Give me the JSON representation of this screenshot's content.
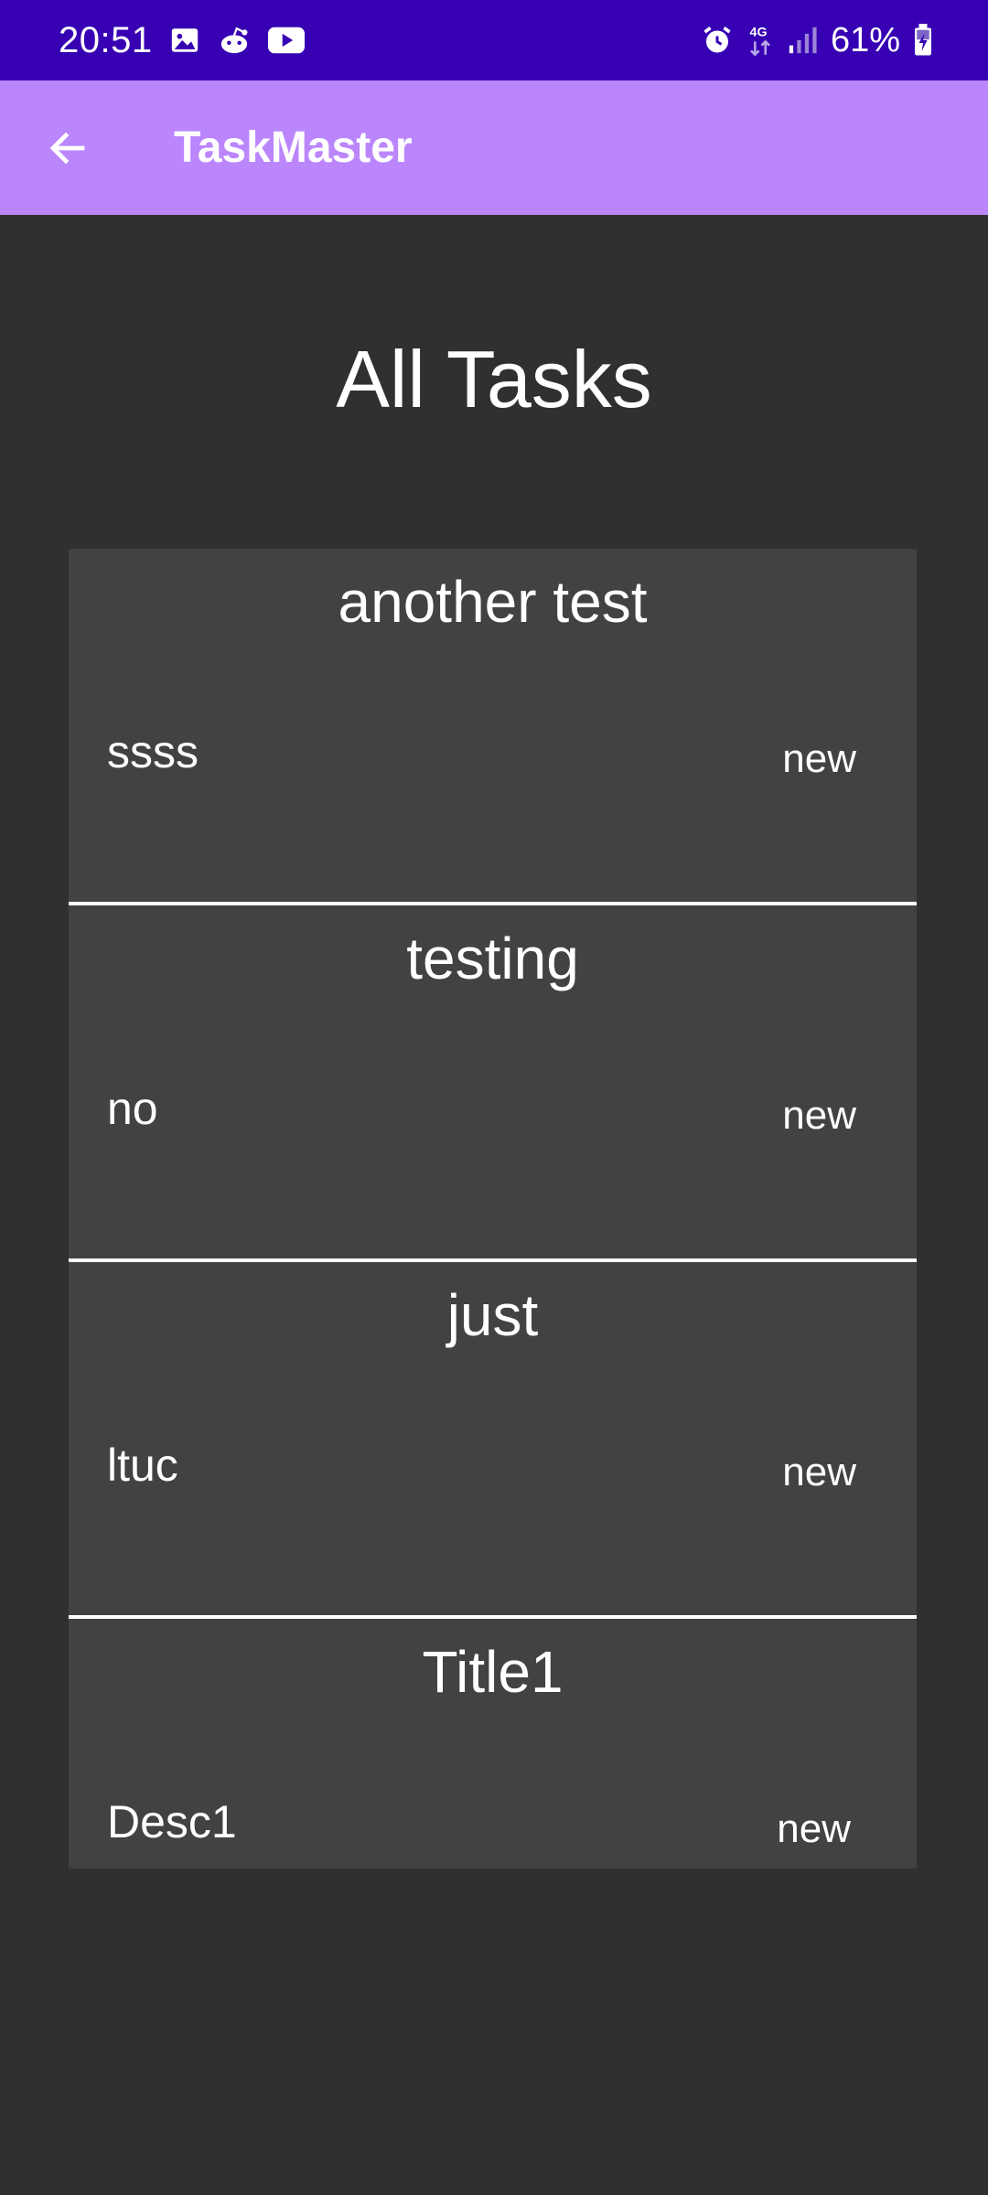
{
  "status_bar": {
    "time": "20:51",
    "left_icons": [
      "gallery-icon",
      "reddit-icon",
      "youtube-icon"
    ],
    "right_icons": [
      "alarm-icon",
      "network-4g-icon",
      "signal-icon",
      "battery-charging-icon"
    ],
    "network_label": "4G",
    "battery": "61%",
    "background": "#3700b3"
  },
  "app_bar": {
    "title": "TaskMaster",
    "back_icon": "arrow-back-icon",
    "background": "#bb86fc"
  },
  "page": {
    "heading": "All Tasks",
    "background": "#303030"
  },
  "tasks": [
    {
      "title": "another test",
      "description": "ssss",
      "state": "new"
    },
    {
      "title": "testing",
      "description": "no",
      "state": "new"
    },
    {
      "title": "just",
      "description": "ltuc",
      "state": "new"
    },
    {
      "title": "Title1",
      "description": "Desc1",
      "state": "new"
    }
  ],
  "colors": {
    "card": "#424242",
    "divider": "#ffffff",
    "text": "#ffffff"
  }
}
